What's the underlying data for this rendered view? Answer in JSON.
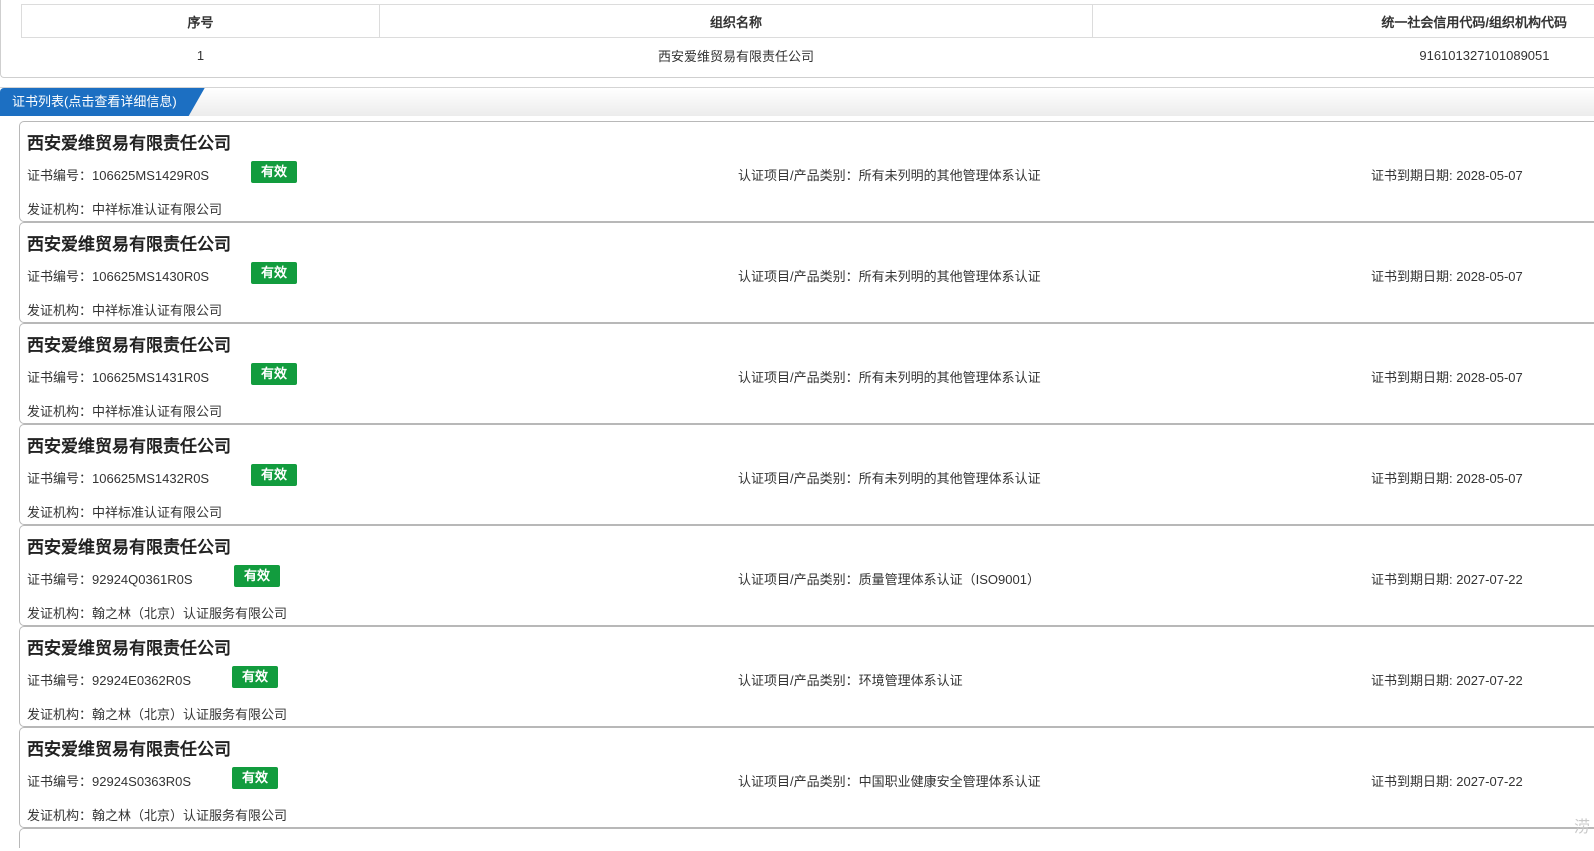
{
  "org_table": {
    "headers": [
      "序号",
      "组织名称",
      "统一社会信用代码/组织机构代码"
    ],
    "rows": [
      [
        "1",
        "西安爱维贸易有限责任公司",
        "916101327101089051"
      ]
    ]
  },
  "section": {
    "title": "证书列表(点击查看详细信息)"
  },
  "labels": {
    "cert_no": "证书编号：",
    "item": "认证项目/产品类别：",
    "expiry": "证书到期日期: ",
    "issuer": "发证机构："
  },
  "certificates": [
    {
      "company": "西安爱维贸易有限责任公司",
      "cert_no": "106625MS1429R0S",
      "status": "有效",
      "item": "所有未列明的其他管理体系认证",
      "expiry": "2028-05-07",
      "issuer": "中祥标准认证有限公司"
    },
    {
      "company": "西安爱维贸易有限责任公司",
      "cert_no": "106625MS1430R0S",
      "status": "有效",
      "item": "所有未列明的其他管理体系认证",
      "expiry": "2028-05-07",
      "issuer": "中祥标准认证有限公司"
    },
    {
      "company": "西安爱维贸易有限责任公司",
      "cert_no": "106625MS1431R0S",
      "status": "有效",
      "item": "所有未列明的其他管理体系认证",
      "expiry": "2028-05-07",
      "issuer": "中祥标准认证有限公司"
    },
    {
      "company": "西安爱维贸易有限责任公司",
      "cert_no": "106625MS1432R0S",
      "status": "有效",
      "item": "所有未列明的其他管理体系认证",
      "expiry": "2028-05-07",
      "issuer": "中祥标准认证有限公司"
    },
    {
      "company": "西安爱维贸易有限责任公司",
      "cert_no": "92924Q0361R0S",
      "status": "有效",
      "item": "质量管理体系认证（ISO9001）",
      "expiry": "2027-07-22",
      "issuer": "翰之林（北京）认证服务有限公司"
    },
    {
      "company": "西安爱维贸易有限责任公司",
      "cert_no": "92924E0362R0S",
      "status": "有效",
      "item": "环境管理体系认证",
      "expiry": "2027-07-22",
      "issuer": "翰之林（北京）认证服务有限公司"
    },
    {
      "company": "西安爱维贸易有限责任公司",
      "cert_no": "92924S0363R0S",
      "status": "有效",
      "item": "中国职业健康安全管理体系认证",
      "expiry": "2027-07-22",
      "issuer": "翰之林（北京）认证服务有限公司"
    }
  ],
  "watermark": "涝",
  "colors": {
    "section_tab": "#1c6fc2",
    "status_valid": "#129c3e"
  }
}
